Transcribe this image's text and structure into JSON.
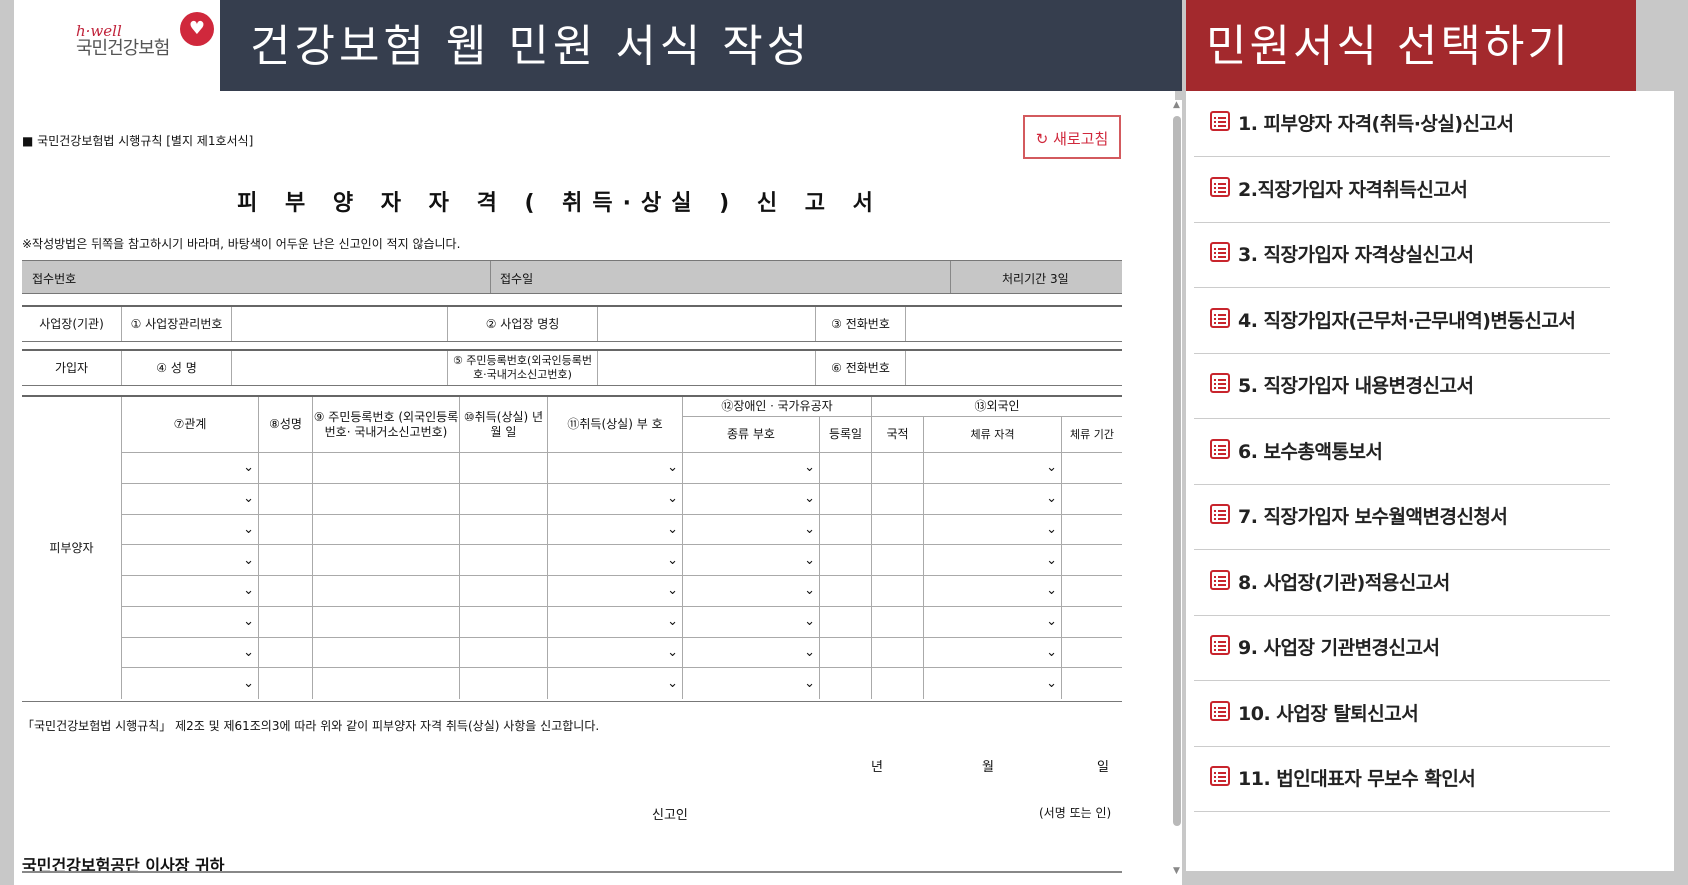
{
  "logo": {
    "tag": "h·well",
    "name": "국민건강보험"
  },
  "banners": {
    "left": "건강보험 웹 민원 서식 작성",
    "right": "민원서식 선택하기"
  },
  "form": {
    "source": "■ 국민건강보험법 시행규칙 [별지 제1호서식]",
    "refresh": "새로고침",
    "title": "피 부 양 자 자 격 ( 취득·상실 ) 신 고 서",
    "note": "※작성방법은 뒤쪽을 참고하시기 바라며, 바탕색이 어두운 난은 신고인이 적지 않습니다.",
    "header": {
      "receipt_no": "접수번호",
      "receipt_date": "접수일",
      "period": "처리기간  3일"
    },
    "workplace": {
      "label": "사업장(기관)",
      "f1": "① 사업장관리번호",
      "f2": "② 사업장 명칭",
      "f3": "③ 전화번호"
    },
    "subscriber": {
      "label": "가입자",
      "f4": "④ 성 명",
      "f5": "⑤ 주민등록번호(외국인등록번호·국내거소신고번호)",
      "f6": "⑥ 전화번호"
    },
    "dependent": {
      "label": "피부양자",
      "c7": "⑦관계",
      "c8": "⑧성명",
      "c9": "⑨ 주민등록번호 (외국인등록번호· 국내거소신고번호)",
      "c10": "⑩취득(상실) 년 월 일",
      "c11": "⑪취득(상실) 부 호",
      "c12": "⑫장애인ㆍ국가유공자",
      "c12a": "종류 부호",
      "c12b": "등록일",
      "c13": "⑬외국인",
      "c13a": "국적",
      "c13b": "체류 자격",
      "c13c": "체류 기간",
      "rows": 8,
      "chevron": "⌄"
    },
    "declaration": "「국민건강보험법 시행규칙」 제2조 및 제61조의3에 따라 위와 같이 피부양자 자격 취득(상실) 사항을 신고합니다.",
    "date": {
      "y": "년",
      "m": "월",
      "d": "일"
    },
    "signer": "신고인",
    "sign": "(서명 또는 인)",
    "recipient": "국민건강보험공단 이사장 귀하"
  },
  "menu": [
    "1. 피부양자 자격(취득·상실)신고서",
    "2.직장가입자 자격취득신고서",
    "3. 직장가입자 자격상실신고서",
    "4. 직장가입자(근무처·근무내역)변동신고서",
    "5. 직장가입자 내용변경신고서",
    "6. 보수총액통보서",
    "7. 직장가입자 보수월액변경신청서",
    "8. 사업장(기관)적용신고서",
    "9. 사업장 기관변경신고서",
    "10. 사업장 탈퇴신고서",
    "11. 법인대표자 무보수 확인서"
  ],
  "colors": {
    "banner_left": "#363e4e",
    "banner_right": "#a3292d",
    "accent": "#c8252d"
  }
}
